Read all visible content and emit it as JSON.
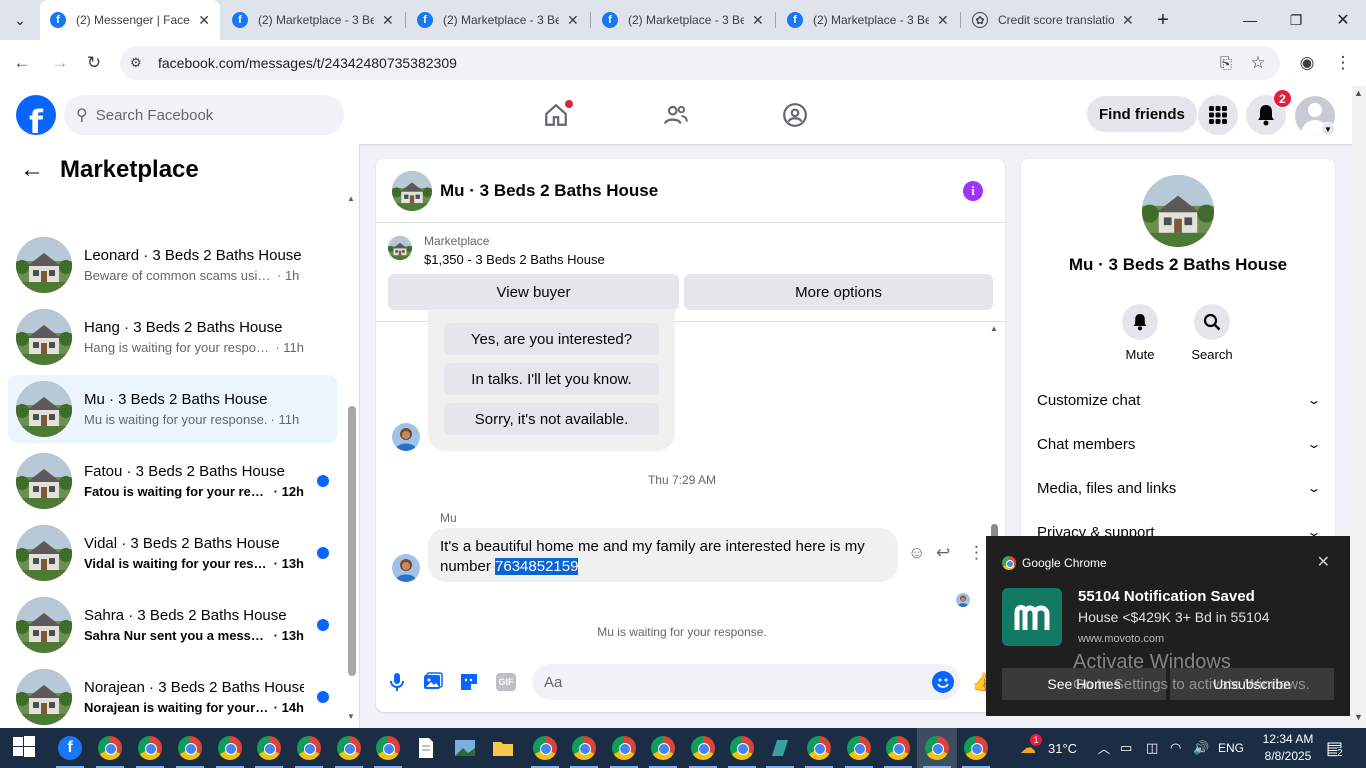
{
  "browser": {
    "tabs": [
      {
        "title": "(2) Messenger | Faceb",
        "favicon": "facebook-icon",
        "active": true
      },
      {
        "title": "(2) Marketplace - 3 Be",
        "favicon": "facebook-icon",
        "active": false
      },
      {
        "title": "(2) Marketplace - 3 Be",
        "favicon": "facebook-icon",
        "active": false
      },
      {
        "title": "(2) Marketplace - 3 Be",
        "favicon": "facebook-icon",
        "active": false
      },
      {
        "title": "(2) Marketplace - 3 Be",
        "favicon": "facebook-icon",
        "active": false
      },
      {
        "title": "Credit score translatio",
        "favicon": "chatgpt-icon",
        "active": false
      }
    ],
    "url": "facebook.com/messages/t/24342480735382309"
  },
  "fb_header": {
    "search_placeholder": "Search Facebook",
    "find_friends": "Find friends",
    "notification_count": "2"
  },
  "sidebar": {
    "title": "Marketplace",
    "conversations": [
      {
        "name": "",
        "preview": "Beware of common scams using pa...",
        "time": "· 1h",
        "unread": false,
        "selected": false
      },
      {
        "name": "Leonard · 3 Beds 2 Baths House",
        "preview": "Beware of common scams using pa...",
        "time": "· 1h",
        "unread": false,
        "selected": false
      },
      {
        "name": "Hang · 3 Beds 2 Baths House",
        "preview": "Hang is waiting for your response.",
        "time": "· 11h",
        "unread": false,
        "selected": false
      },
      {
        "name": "Mu · 3 Beds 2 Baths House",
        "preview": "Mu is waiting for your response.",
        "time": "· 11h",
        "unread": false,
        "selected": true
      },
      {
        "name": "Fatou · 3 Beds 2 Baths House",
        "preview": "Fatou is waiting for your respo...",
        "time": "· 12h",
        "unread": true,
        "selected": false
      },
      {
        "name": "Vidal · 3 Beds 2 Baths House",
        "preview": "Vidal is waiting for your respo...",
        "time": "· 13h",
        "unread": true,
        "selected": false
      },
      {
        "name": "Sahra · 3 Beds 2 Baths House",
        "preview": "Sahra Nur sent you a message ...",
        "time": "· 13h",
        "unread": true,
        "selected": false
      },
      {
        "name": "Norajean · 3 Beds 2 Baths House",
        "preview": "Norajean is waiting for your re...",
        "time": "· 14h",
        "unread": true,
        "selected": false
      }
    ]
  },
  "chat": {
    "title": "Mu · 3 Beds 2 Baths House",
    "marketplace_label": "Marketplace",
    "listing": "$1,350 - 3 Beds 2 Baths House",
    "view_buyer": "View buyer",
    "more_options": "More options",
    "quick_replies": [
      "Yes, are you interested?",
      "In talks. I'll let you know.",
      "Sorry, it's not available."
    ],
    "timestamp": "Thu 7:29 AM",
    "sender": "Mu",
    "message_text": "It's a beautiful home me and my family are interested here is my number ",
    "message_number": "7634852159",
    "waiting": "Mu is waiting for your response.",
    "composer_placeholder": "Aa",
    "gif_label": "GIF"
  },
  "right_panel": {
    "name": "Mu · 3 Beds 2 Baths House",
    "mute": "Mute",
    "search": "Search",
    "sections": [
      "Customize chat",
      "Chat members",
      "Media, files and links",
      "Privacy & support"
    ]
  },
  "notification": {
    "app": "Google Chrome",
    "title": "55104 Notification Saved",
    "body": "House <$429K 3+ Bd in 55104",
    "source": "www.movoto.com",
    "btn1": "See Homes",
    "btn2": "Unsubscribe"
  },
  "watermark": {
    "line1": "Activate Windows",
    "line2": "Go to Settings to activate Windows."
  },
  "taskbar": {
    "weather_temp": "31°C",
    "weather_badge": "1",
    "language": "ENG",
    "time": "12:34 AM",
    "date": "8/8/2025",
    "notif_count": "2"
  },
  "colors": {
    "fb_blue": "#0866ff",
    "selected_bg": "#ebf5ff",
    "info_purple": "#a033ff",
    "badge_red": "#e41e3f",
    "highlight": "#0a64d8"
  }
}
